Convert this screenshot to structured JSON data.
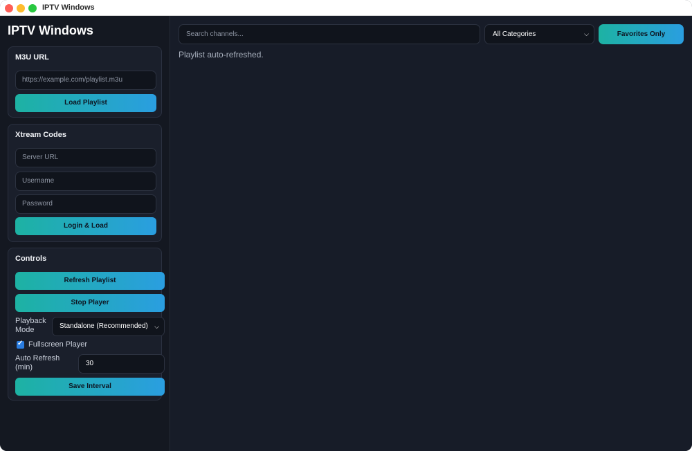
{
  "window": {
    "title": "IPTV Windows"
  },
  "sidebar": {
    "app_title": "IPTV Windows",
    "m3u": {
      "title": "M3U URL",
      "url_placeholder": "https://example.com/playlist.m3u",
      "load_label": "Load Playlist"
    },
    "xtream": {
      "title": "Xtream Codes",
      "server_placeholder": "Server URL",
      "username_placeholder": "Username",
      "password_placeholder": "Password",
      "login_label": "Login & Load"
    },
    "controls": {
      "title": "Controls",
      "refresh_label": "Refresh Playlist",
      "stop_label": "Stop Player",
      "playback_mode_label_1": "Playback",
      "playback_mode_label_2": "Mode",
      "playback_mode_value": "Standalone (Recommended)",
      "fullscreen_label": "Fullscreen Player",
      "fullscreen_checked": true,
      "auto_refresh_label_1": "Auto Refresh",
      "auto_refresh_label_2": "(min)",
      "auto_refresh_value": "30",
      "save_interval_label": "Save Interval"
    }
  },
  "main": {
    "search_placeholder": "Search channels...",
    "category_value": "All Categories",
    "favorites_label": "Favorites Only",
    "status_text": "Playlist auto-refreshed."
  },
  "colors": {
    "accent_start": "#1db2a3",
    "accent_end": "#2a9ee0",
    "background": "#171c28",
    "sidebar_bg": "#141821"
  },
  "icons": {
    "select_chevron": "chevron-down-icon",
    "checkbox": "checkmark-icon"
  }
}
